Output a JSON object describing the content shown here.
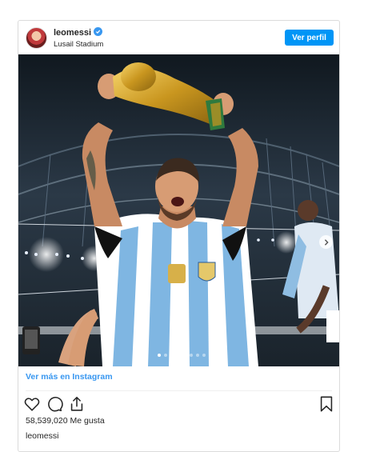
{
  "post": {
    "username": "leomessi",
    "location": "Lusail Stadium",
    "follow_label": "Ver perfil",
    "view_more_label": "Ver más en Instagram",
    "likes_count": "58,539,020",
    "likes_suffix": "Me gusta",
    "caption_username": "leomessi",
    "carousel_total": 10,
    "carousel_active": 0
  },
  "colors": {
    "accent": "#0095f6",
    "link": "#3897f0",
    "verified": "#3897f0"
  },
  "icons": [
    "verified-badge-icon",
    "heart-icon",
    "comment-icon",
    "share-icon",
    "bookmark-icon",
    "chevron-right-icon"
  ]
}
